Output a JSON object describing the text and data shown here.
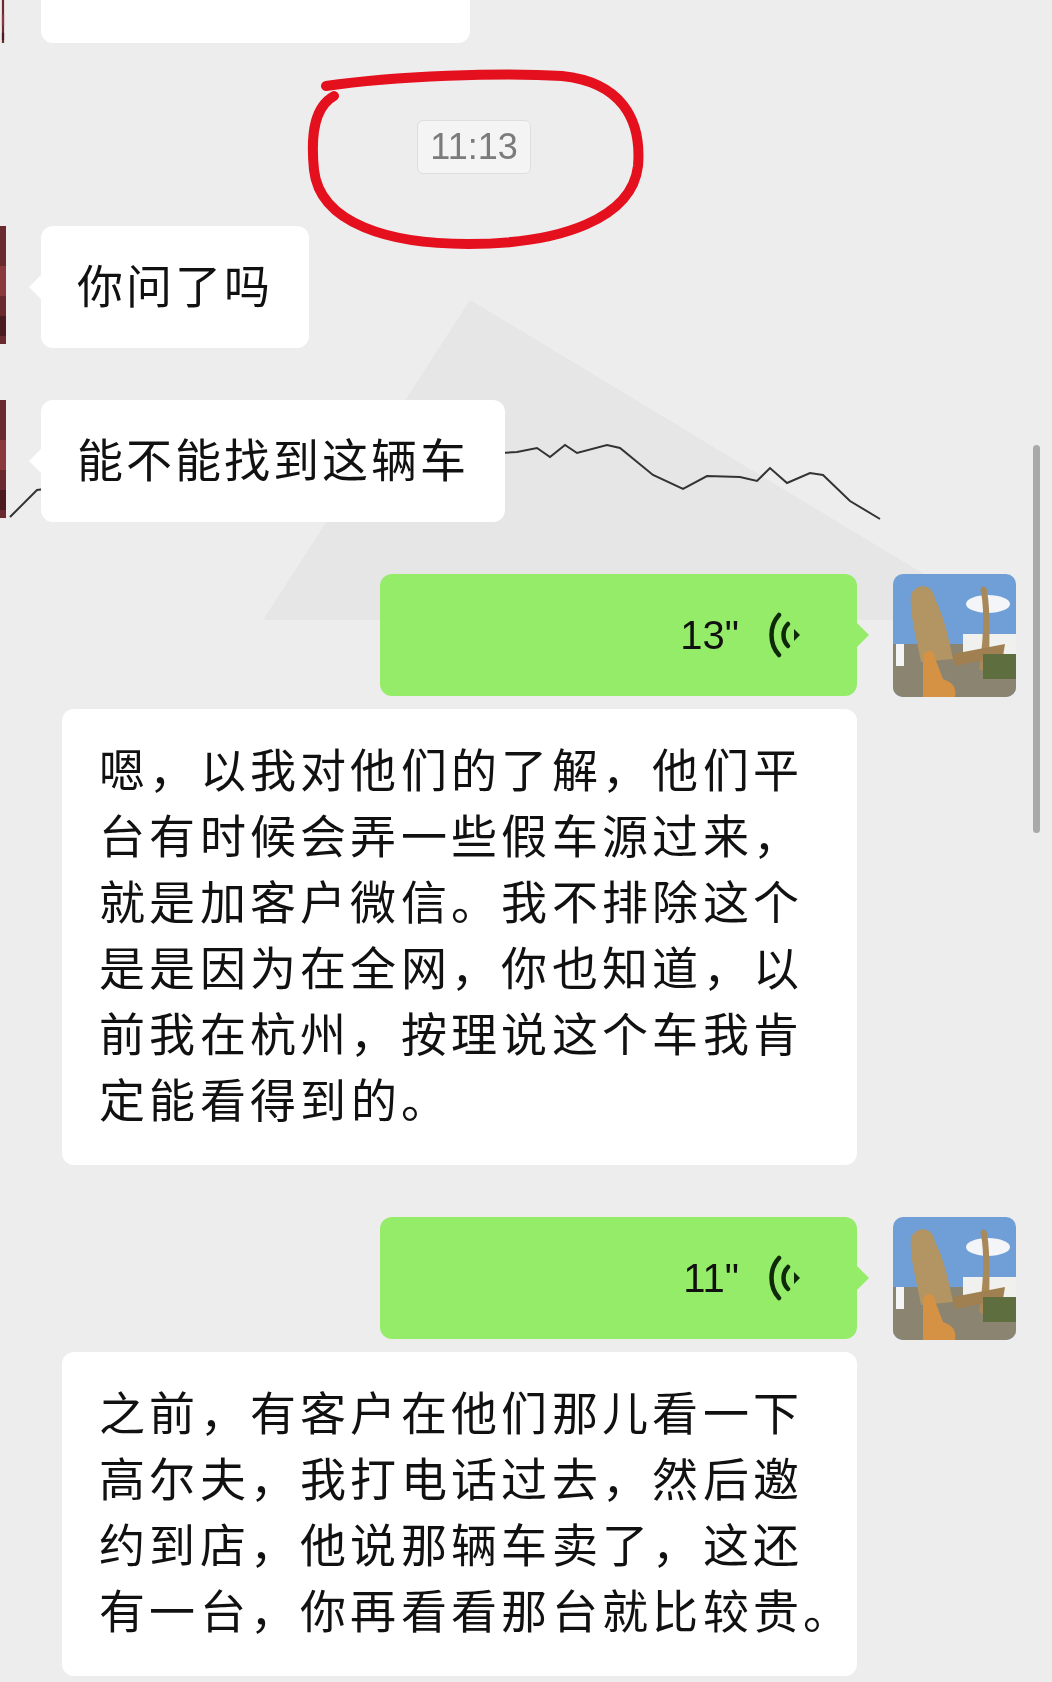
{
  "messages": [
    {
      "kind": "cut_off"
    },
    {
      "kind": "time",
      "text": "11:13",
      "circled": true
    },
    {
      "kind": "text",
      "text": "你问了吗"
    },
    {
      "kind": "text",
      "text": "能不能找到这辆车"
    },
    {
      "kind": "voice",
      "duration": "13\""
    },
    {
      "kind": "transcript",
      "text": "嗯，以我对他们的了解，他们平台有时候会弄一些假车源过来，就是加客户微信。我不排除这个是是因为在全网，你也知道，以前我在杭州，按理说这个车我肯定能看得到的。"
    },
    {
      "kind": "voice",
      "duration": "11\""
    },
    {
      "kind": "transcript",
      "text": "之前，有客户在他们那儿看一下高尔夫，我打电话过去，然后邀约到店，他说那辆车卖了，这还有一台，你再看看那台就比较贵。"
    }
  ]
}
